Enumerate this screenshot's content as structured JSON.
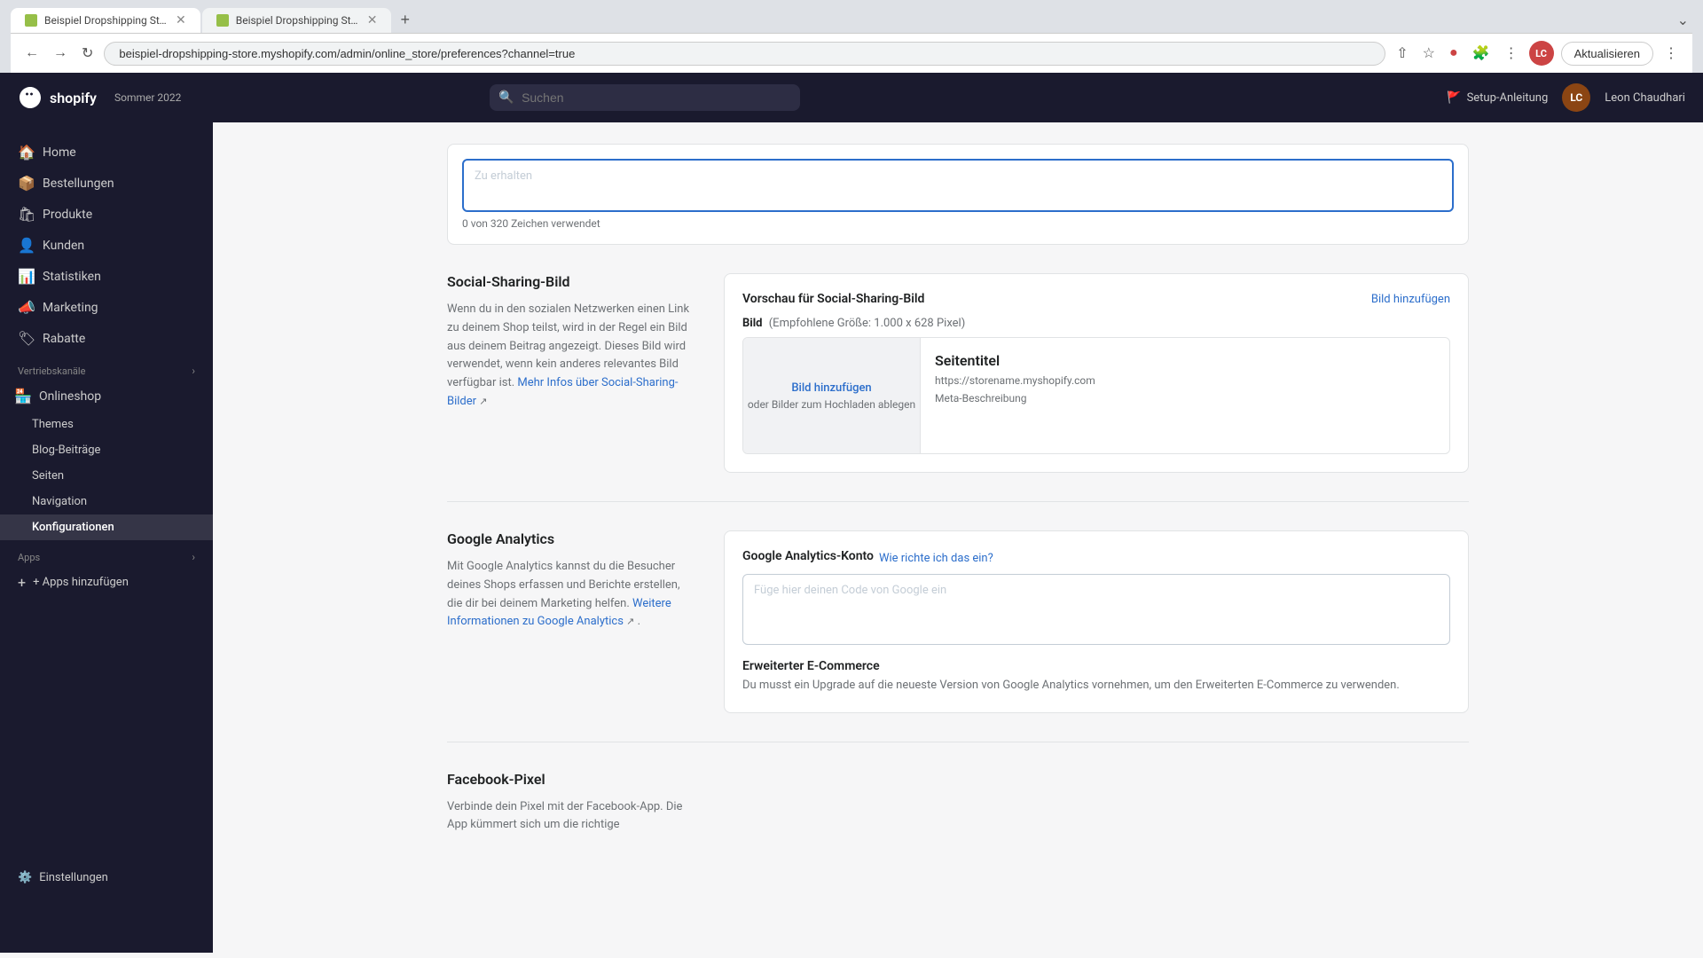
{
  "browser": {
    "tabs": [
      {
        "id": "tab1",
        "title": "Beispiel Dropshipping Store ·...",
        "active": true
      },
      {
        "id": "tab2",
        "title": "Beispiel Dropshipping Store",
        "active": false
      }
    ],
    "address": "beispiel-dropshipping-store.myshopify.com/admin/online_store/preferences?channel=true",
    "update_btn": "Aktualisieren"
  },
  "shopify": {
    "logo_text": "shopify",
    "season": "Sommer 2022",
    "search_placeholder": "Suchen",
    "setup_link": "Setup-Anleitung",
    "user_initials": "LC",
    "user_name": "Leon Chaudhari"
  },
  "sidebar": {
    "items": [
      {
        "id": "home",
        "label": "Home",
        "icon": "🏠"
      },
      {
        "id": "bestellungen",
        "label": "Bestellungen",
        "icon": "📦"
      },
      {
        "id": "produkte",
        "label": "Produkte",
        "icon": "🛍"
      },
      {
        "id": "kunden",
        "label": "Kunden",
        "icon": "👤"
      },
      {
        "id": "statistiken",
        "label": "Statistiken",
        "icon": "📊"
      },
      {
        "id": "marketing",
        "label": "Marketing",
        "icon": "📣"
      },
      {
        "id": "rabatte",
        "label": "Rabatte",
        "icon": "🏷"
      }
    ],
    "vertriebskanaele_label": "Vertriebskanäle",
    "vertriebskanaele_items": [
      {
        "id": "onlineshop",
        "label": "Onlineshop",
        "icon": "🏪",
        "active": true
      },
      {
        "id": "themes",
        "label": "Themes",
        "sub": true
      },
      {
        "id": "blog-beitraege",
        "label": "Blog-Beiträge",
        "sub": true
      },
      {
        "id": "seiten",
        "label": "Seiten",
        "sub": true
      },
      {
        "id": "navigation",
        "label": "Navigation",
        "sub": true
      },
      {
        "id": "konfigurationen",
        "label": "Konfigurationen",
        "sub": true,
        "active": true
      }
    ],
    "apps_label": "Apps",
    "apps_add": "+ Apps hinzufügen",
    "einstellungen": "Einstellungen"
  },
  "page": {
    "social_sharing": {
      "section_title": "Social-Sharing-Bild",
      "section_desc": "Wenn du in den sozialen Netzwerken einen Link zu deinem Shop teilst, wird in der Regel ein Bild aus deinem Beitrag angezeigt. Dieses Bild wird verwendet, wenn kein anderes relevantes Bild verfügbar ist.",
      "link_text": "Mehr Infos über Social-Sharing-Bilder",
      "card_title": "Vorschau für Social-Sharing-Bild",
      "card_link": "Bild hinzufügen",
      "bild_label": "Bild",
      "bild_hint": "(Empfohlene Größe: 1.000 x 628 Pixel)",
      "upload_btn": "Bild hinzufügen",
      "upload_hint": "oder Bilder zum Hochladen ablegen",
      "preview_title": "Seitentitel",
      "preview_url": "https://storename.myshopify.com",
      "preview_desc": "Meta-Beschreibung"
    },
    "meta_desc": {
      "char_count": "0 von 320 Zeichen verwendet"
    },
    "google_analytics": {
      "section_title": "Google Analytics",
      "section_desc": "Mit Google Analytics kannst du die Besucher deines Shops erfassen und Berichte erstellen, die dir bei deinem Marketing helfen.",
      "link_text": "Weitere Informationen zu Google Analytics",
      "card_title": "Google Analytics-Konto",
      "card_subtitle_link": "Wie richte ich das ein?",
      "field_placeholder": "Füge hier deinen Code von Google ein",
      "erweiterter_title": "Erweiterter E-Commerce",
      "erweiterter_desc": "Du musst ein Upgrade auf die neueste Version von Google Analytics vornehmen, um den Erweiterten E-Commerce zu verwenden."
    },
    "facebook_pixel": {
      "section_title": "Facebook-Pixel",
      "section_desc": "Verbinde dein Pixel mit der Facebook-App. Die App kümmert sich um die richtige"
    }
  }
}
